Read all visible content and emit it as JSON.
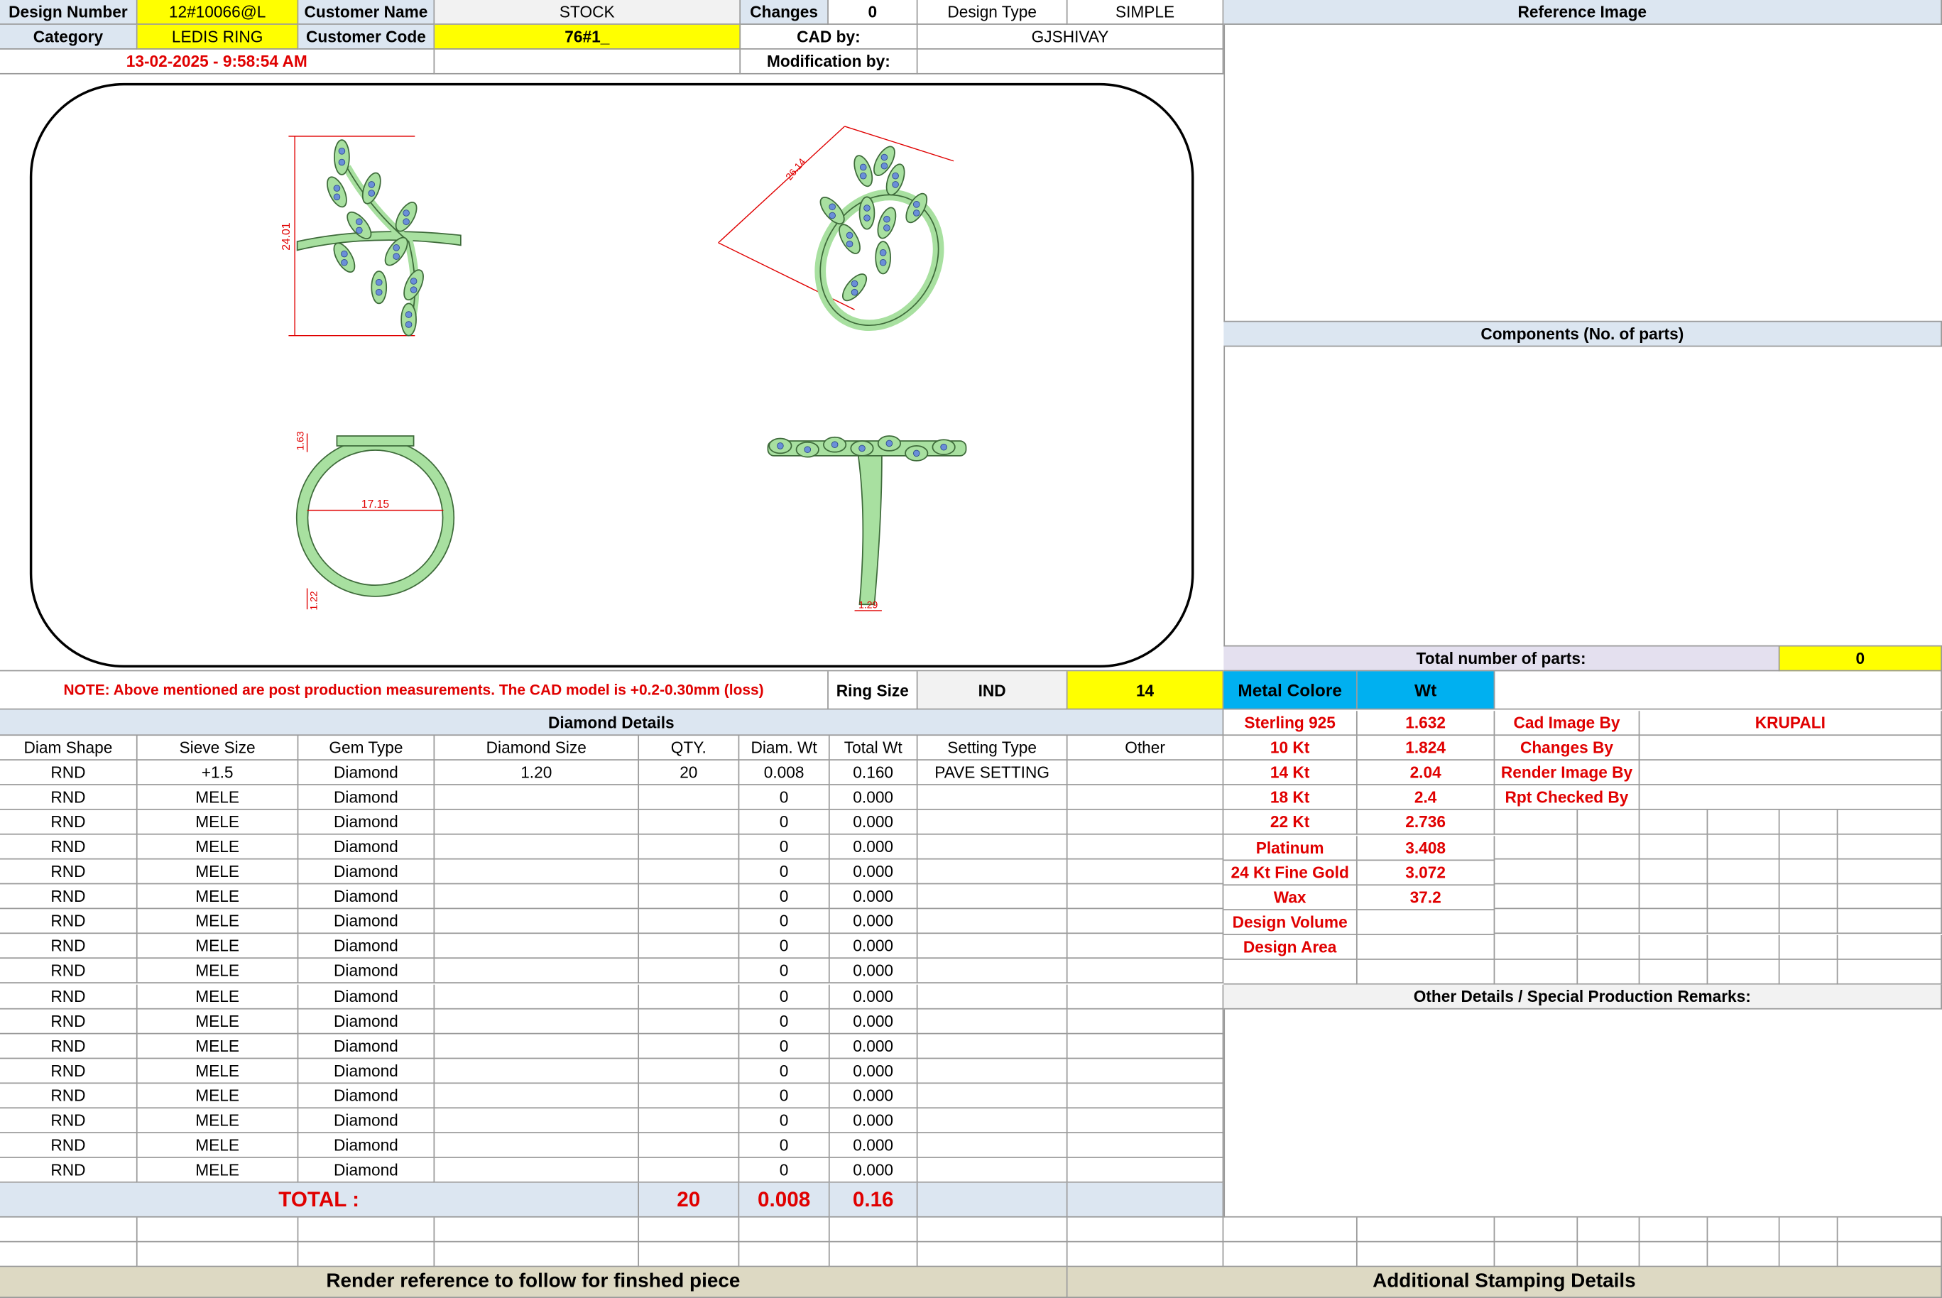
{
  "header": {
    "design_number_label": "Design Number",
    "design_number": "12#10066@L",
    "customer_name_label": "Customer Name",
    "customer_name": "STOCK",
    "changes_label": "Changes",
    "changes": "0",
    "design_type_label": "Design Type",
    "design_type": "SIMPLE",
    "category_label": "Category",
    "category": "LEDIS RING",
    "customer_code_label": "Customer Code",
    "customer_code": "76#1_",
    "cad_by_label": "CAD by:",
    "cad_by": "GJSHIVAY",
    "timestamp": "13-02-2025 - 9:58:54 AM",
    "modification_by_label": "Modification by:"
  },
  "reference_image": {
    "title": "Reference Image"
  },
  "components": {
    "title": "Components (No. of parts)"
  },
  "total_parts": {
    "label": "Total number of parts:",
    "value": "0"
  },
  "drawings": {
    "dim_height": "24.01",
    "dim_diagonal": "26.14",
    "dim_top": "1.63",
    "dim_inner": "17.15",
    "dim_bottom": "1.22",
    "dim_width": "1.29"
  },
  "note": {
    "text": "NOTE: Above mentioned are post production measurements. The CAD model is +0.2-0.30mm (loss)",
    "ring_size_label": "Ring Size",
    "ring_size_std": "IND",
    "ring_size": "14"
  },
  "metal": {
    "color_label": "Metal Colore",
    "wt_label": "Wt",
    "rows": [
      {
        "name": "Sterling 925",
        "wt": "1.632"
      },
      {
        "name": "10 Kt",
        "wt": "1.824"
      },
      {
        "name": "14 Kt",
        "wt": "2.04"
      },
      {
        "name": "18 Kt",
        "wt": "2.4"
      },
      {
        "name": "22 Kt",
        "wt": "2.736"
      },
      {
        "name": "Platinum",
        "wt": "3.408"
      },
      {
        "name": "24 Kt Fine Gold",
        "wt": "3.072"
      },
      {
        "name": "Wax",
        "wt": "37.2"
      },
      {
        "name": "Design Volume",
        "wt": ""
      },
      {
        "name": "Design Area",
        "wt": ""
      }
    ]
  },
  "credits": {
    "cad_image_by_label": "Cad Image By",
    "cad_image_by": "KRUPALI",
    "changes_by_label": "Changes By",
    "render_image_by_label": "Render Image By",
    "rpt_checked_by_label": "Rpt Checked By"
  },
  "diamond_details": {
    "title": "Diamond Details",
    "headers": [
      "Diam Shape",
      "Sieve Size",
      "Gem Type",
      "Diamond Size",
      "QTY.",
      "Diam. Wt",
      "Total Wt",
      "Setting Type",
      "Other"
    ],
    "rows": [
      [
        "RND",
        "+1.5",
        "Diamond",
        "1.20",
        "20",
        "0.008",
        "0.160",
        "PAVE SETTING",
        ""
      ],
      [
        "RND",
        "MELE",
        "Diamond",
        "",
        "",
        "0",
        "0.000",
        "",
        ""
      ],
      [
        "RND",
        "MELE",
        "Diamond",
        "",
        "",
        "0",
        "0.000",
        "",
        ""
      ],
      [
        "RND",
        "MELE",
        "Diamond",
        "",
        "",
        "0",
        "0.000",
        "",
        ""
      ],
      [
        "RND",
        "MELE",
        "Diamond",
        "",
        "",
        "0",
        "0.000",
        "",
        ""
      ],
      [
        "RND",
        "MELE",
        "Diamond",
        "",
        "",
        "0",
        "0.000",
        "",
        ""
      ],
      [
        "RND",
        "MELE",
        "Diamond",
        "",
        "",
        "0",
        "0.000",
        "",
        ""
      ],
      [
        "RND",
        "MELE",
        "Diamond",
        "",
        "",
        "0",
        "0.000",
        "",
        ""
      ],
      [
        "RND",
        "MELE",
        "Diamond",
        "",
        "",
        "0",
        "0.000",
        "",
        ""
      ],
      [
        "RND",
        "MELE",
        "Diamond",
        "",
        "",
        "0",
        "0.000",
        "",
        ""
      ],
      [
        "RND",
        "MELE",
        "Diamond",
        "",
        "",
        "0",
        "0.000",
        "",
        ""
      ],
      [
        "RND",
        "MELE",
        "Diamond",
        "",
        "",
        "0",
        "0.000",
        "",
        ""
      ],
      [
        "RND",
        "MELE",
        "Diamond",
        "",
        "",
        "0",
        "0.000",
        "",
        ""
      ],
      [
        "RND",
        "MELE",
        "Diamond",
        "",
        "",
        "0",
        "0.000",
        "",
        ""
      ],
      [
        "RND",
        "MELE",
        "Diamond",
        "",
        "",
        "0",
        "0.000",
        "",
        ""
      ],
      [
        "RND",
        "MELE",
        "Diamond",
        "",
        "",
        "0",
        "0.000",
        "",
        ""
      ],
      [
        "RND",
        "MELE",
        "Diamond",
        "",
        "",
        "0",
        "0.000",
        "",
        ""
      ]
    ],
    "total_label": "TOTAL :",
    "total_qty": "20",
    "total_diam_wt": "0.008",
    "total_wt": "0.16"
  },
  "other_details": {
    "title": "Other Details / Special Production Remarks:"
  },
  "footer": {
    "render_reference": "Render reference to follow for finshed piece",
    "stamping": "Additional Stamping Details"
  },
  "colors": {
    "yellow": "#ffff00",
    "light_blue": "#dce6f1",
    "cyan": "#00b0f0",
    "tan": "#ddd9c3",
    "red": "#e00000",
    "ring_green": "#a8e0a0"
  }
}
